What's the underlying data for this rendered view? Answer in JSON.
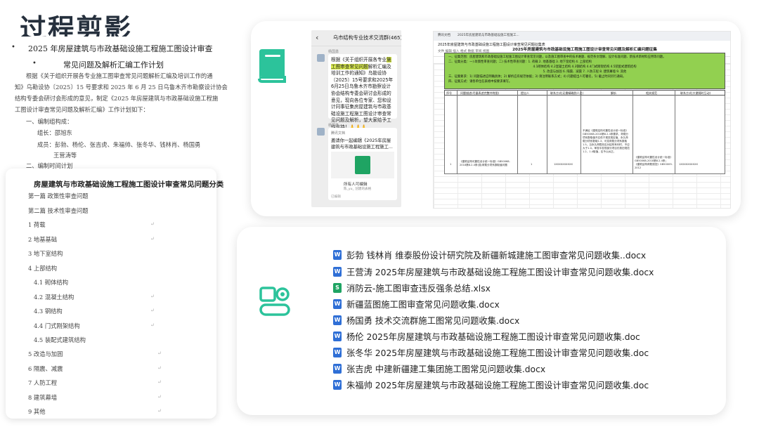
{
  "page": {
    "title": "过程剪影"
  },
  "doc1": {
    "heading1": "2025 年房屋建筑与市政基础设施工程施工图设计审查",
    "heading2": "常见问题及解析汇编工作计划",
    "para": [
      "根据《关于组织开展各专业施工图审查常见问题解析汇编及培训工作的通",
      "知》乌勘设协〔2025〕15 号要求和 2025 年 6 月 25 日乌鲁木齐市勘察设计协会",
      "结构专委会研讨会形成的意见，制定《2025 年房屋建筑与市政基础设施工程施",
      "工图设计审查常见问题及解析汇编》工作计划如下："
    ],
    "s1": "一、编制组构成：",
    "leader": "组长：邵旭东",
    "members": "成员：彭勃、杨伦、张吉虎、朱福帅、张冬华、钱林肖、杨国勇",
    "members2": "王营涛等",
    "s2": "二、编制时间计划"
  },
  "doc2": {
    "heading": "房屋建筑与市政基础设施工程施工图设计审查常见问题分类",
    "rows": [
      "第一篇  政策性审查问题",
      "第二篇  技术性审查问题",
      "1 荷载",
      "2 地基基础",
      "3 地下室结构",
      "4 上部结构",
      "4.1 砌体结构",
      "4.2 混凝土结构",
      "4.3 钢结构",
      "4.4 门式刚架结构",
      "4.5 装配式建筑结构",
      "5 改造与加固",
      "6 隔震、减震",
      "7 人防工程",
      "8 建筑幕墙",
      "9 其他"
    ]
  },
  "chat": {
    "group": "乌市结构专业技术交流群(465)",
    "sender1": "杨国勇",
    "msg_pre": "根据《关于组织开展各专业",
    "msg_hl1": "施工图审查常见问题",
    "msg_post": "解析汇编及培训工作的通知》乌勘设协〔2025〕15号要求和2025年6月25日乌鲁木齐市勘察设计协会结构专委会研讨会形成的意见，现向各位专家、您和设计同事征集房屋建筑与市政基础设施工程施工图设计审查常见问题及解析，望大家给予工作支持！🙏🙏🙏",
    "sender2": "杨国勇",
    "share_src": "腾讯文档",
    "share_title": "邀请你一起编辑《2025年房屋建筑与市政基础设施工程施工...",
    "foot1": "所有人可编辑",
    "foot2": "陈_yu_ 创建的表格",
    "foot3": "已编辑"
  },
  "sheet": {
    "tab1": "腾讯文档",
    "tab2": "2025年房屋建筑与市政基础设施工程施工...",
    "doc_name": "2025年房屋建筑与市政基础设施工程施工图设计审查常见问题征集表",
    "menu": "文件  编辑  插入  格式  数据  审阅  视图",
    "title": "2025年房屋建筑与市政基础设施工程施工图设计审查常见问题及解析汇编问题征集",
    "green": [
      "一、征集范围：房屋建筑和市政基础设施工程施工图设计审查常见问题，以及施工图审查中的技术难题、规范条文理解、设计标准问题、新技术新材料应用等问题。",
      "二、征集分类：一) 政策性审查问题；二) 技术性审查问题：1. 荷载 2. 地基基础 3. 地下室结构 4. 上部结构",
      "4.1砌体结构  4.2混凝土结构  4.3钢结构  4.4门式刚架结构  4.5装配式建筑结构",
      "5. 改造与加固  6. 隔震、减震  7. 人防工程  8. 建筑幕墙  9. 其他",
      "三、征集要求：1) 问题描述应明确具体；2) 解析应有规范依据；3) 请注明联系方式；4) 问题提出人可署名，5) 截止时间另行通知。",
      "四、征集方式：请各单位在表格中按要求填写。"
    ],
    "headers": [
      "序号",
      "问题描述(尽量表述完整并附图)",
      "提出人",
      "联系方式(无需精确到人名)",
      "解析",
      "相关规范",
      "联系方式(大便随时互动)"
    ],
    "cell_issue": "《建筑结构可靠性设计统一标准》GB50068-2018第8.2.4条(强)荷载分项系数取值问题",
    "cell_num": "1",
    "cell_no": "1",
    "cell_phone": "1XXXXXXXXXX",
    "cell_answer": "不满足《建筑结构可靠性设计统一标准》GB50068-2018第8.2.4条要求，荷载分项系数取值不应低于规范规定值，永久荷载分项系数取1.3，可变荷载分项系数取1.5。当永久荷载效应对结构有利时，不应大于1.0。审查中发现部分项目仍按旧规范1.2、1.4取值，应予以纠正。",
    "cell_ref": "《建筑结构可靠性设计统一标准》GB50068-2018第8.2.4条；《建筑结构荷载规范》GB50009-2012",
    "cell_contact": "1XXXXXXXXXX"
  },
  "files": [
    {
      "type": "doc",
      "name": "彭勃 钱林肖 维泰股份设计研究院及新疆新城建施工图审查常见问题收集..docx"
    },
    {
      "type": "doc",
      "name": "王营涛 2025年房屋建筑与市政基础设施工程施工图设计审查常见问题收集.docx"
    },
    {
      "type": "xls",
      "name": "消防云-施工图审查违反强条总结.xlsx"
    },
    {
      "type": "doc",
      "name": "新疆蓝图施工图审查常见问题收集.docx"
    },
    {
      "type": "doc",
      "name": "杨国勇 技术交流群施工图常见问题收集.docx"
    },
    {
      "type": "doc",
      "name": "杨伦  2025年房屋建筑与市政基础设施工程施工图设计审查常见问题收集.doc"
    },
    {
      "type": "doc",
      "name": "张冬华 2025年房屋建筑与市政基础设施工程施工图设计审查常见问题收集.doc"
    },
    {
      "type": "doc",
      "name": "张吉虎  中建新疆建工集团施工图常见问题收集.docx"
    },
    {
      "type": "doc",
      "name": "朱福帅 2025年房屋建筑与市政基础设施工程施工图设计审查常见问题收集.doc"
    }
  ],
  "icons": {
    "word": "W",
    "excel": "S"
  },
  "colors": {
    "accent": "#2cc39b",
    "green_fill": "#92d050",
    "highlight": "#d8e94d"
  }
}
